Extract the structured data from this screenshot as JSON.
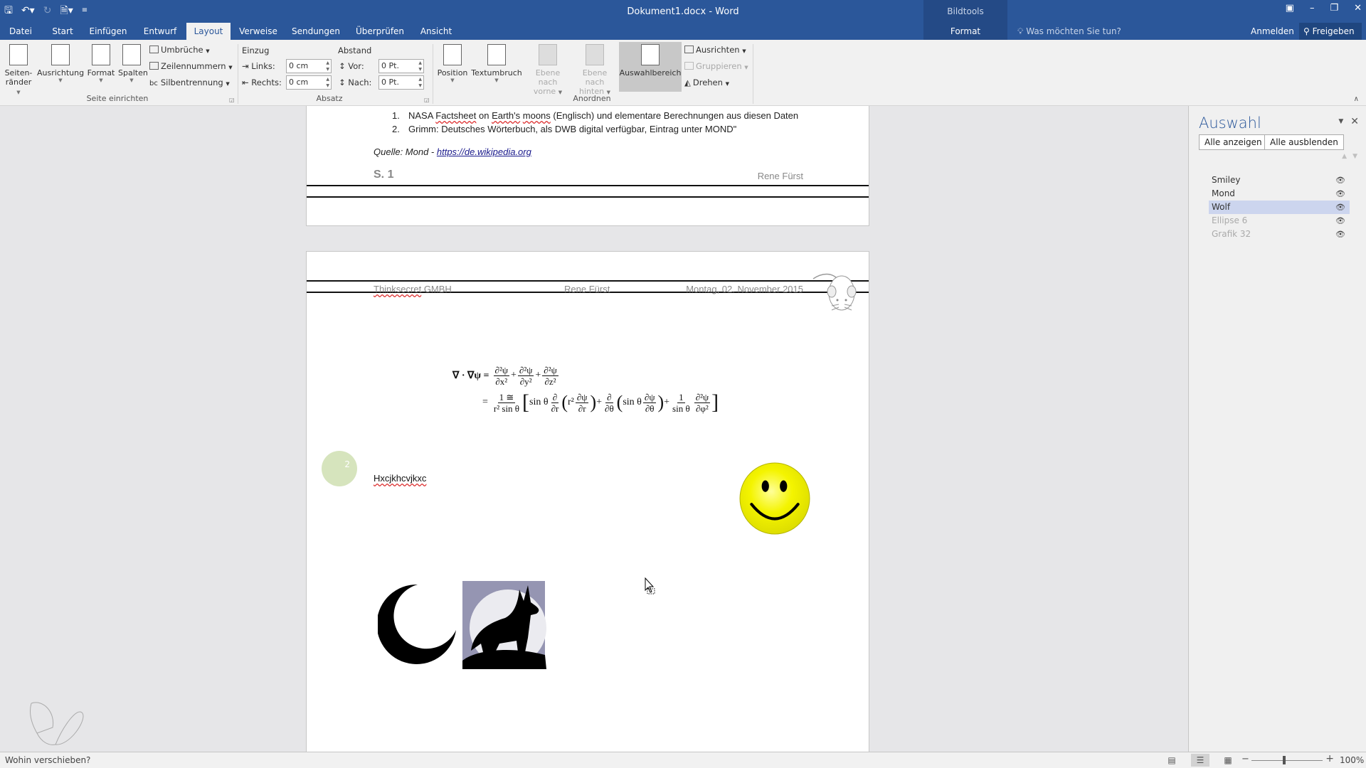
{
  "titlebar": {
    "title": "Dokument1.docx - Word",
    "contextual_group": "Bildtools",
    "qat": [
      "save-icon",
      "undo-icon",
      "redo-icon",
      "new-doc-icon",
      "customize-icon"
    ],
    "window_controls": {
      "ribbon_display": "▣",
      "minimize": "–",
      "restore": "❐",
      "close": "✕"
    }
  },
  "tabs": [
    {
      "label": "Datei"
    },
    {
      "label": "Start"
    },
    {
      "label": "Einfügen"
    },
    {
      "label": "Entwurf"
    },
    {
      "label": "Layout",
      "active": true
    },
    {
      "label": "Verweise"
    },
    {
      "label": "Sendungen"
    },
    {
      "label": "Überprüfen"
    },
    {
      "label": "Ansicht"
    },
    {
      "label": "Format"
    }
  ],
  "tell_me": "Was möchten Sie tun?",
  "account": {
    "signin": "Anmelden",
    "share": "Freigeben"
  },
  "ribbon": {
    "seite_einrichten": {
      "label": "Seite einrichten",
      "seitenraender_1": "Seiten-",
      "seitenraender_2": "ränder",
      "ausrichtung": "Ausrichtung",
      "format": "Format",
      "spalten": "Spalten",
      "umbrueche": "Umbrüche",
      "zeilennummern": "Zeilennummern",
      "silbentrennung": "Silbentrennung"
    },
    "absatz": {
      "label": "Absatz",
      "einzug": "Einzug",
      "abstand": "Abstand",
      "links_label": "Links:",
      "links_value": "0 cm",
      "rechts_label": "Rechts:",
      "rechts_value": "0 cm",
      "vor_label": "Vor:",
      "vor_value": "0 Pt.",
      "nach_label": "Nach:",
      "nach_value": "0 Pt."
    },
    "anordnen": {
      "label": "Anordnen",
      "position": "Position",
      "textumbruch": "Textumbruch",
      "ebene_vorne_1": "Ebene nach",
      "ebene_vorne_2": "vorne",
      "ebene_hinten_1": "Ebene nach",
      "ebene_hinten_2": "hinten",
      "auswahlbereich": "Auswahlbereich",
      "ausrichten": "Ausrichten",
      "gruppieren": "Gruppieren",
      "drehen": "Drehen"
    }
  },
  "document": {
    "page1": {
      "list": [
        {
          "num": "1.",
          "pre": "NASA ",
          "w1": "Factsheet",
          "mid": " on ",
          "w2": "Earth's",
          "sp": " ",
          "w3": "moons",
          "post": " (Englisch) und elementare Berechnungen aus diesen Daten"
        },
        {
          "num": "2.",
          "text": "Grimm: Deutsches Wörterbuch, als DWB digital verfügbar, Eintrag unter MOND\""
        }
      ],
      "source_prefix": "Quelle: Mond - ",
      "source_link": "https://de.wikipedia.org",
      "page_number": "S. 1",
      "footer_author": "Rene Fürst"
    },
    "page2": {
      "header_company": "Thinksecret",
      "header_company_suffix": " GMBH",
      "header_author": "Rene Fürst",
      "header_date": "Montag, 02. November 2015",
      "formula": {
        "lhs": "∇ · ∇ψ =",
        "t1n": "∂²ψ",
        "t1d": "∂x²",
        "t2n": "∂²ψ",
        "t2d": "∂y²",
        "t3n": "∂²ψ",
        "t3d": "∂z²",
        "eq": "=",
        "f1n": "1 ≅",
        "f1d": "r² sin θ",
        "sin1": "sin θ",
        "f2n": "∂",
        "f2d": "∂r",
        "r2": "r²",
        "f3n": "∂ψ",
        "f3d": "∂r",
        "f4n": "∂",
        "f4d": "∂θ",
        "sin2": "sin θ",
        "f5n": "∂ψ",
        "f5d": "∂θ",
        "f6n": "1",
        "f6d": "sin θ",
        "f7n": "∂²ψ",
        "f7d": "∂φ²",
        "plus": "+"
      },
      "circle_number": "2",
      "body_text": "Hxcjkhcvjkxc"
    }
  },
  "selection_pane": {
    "title": "Auswahl",
    "show_all": "Alle anzeigen",
    "hide_all": "Alle ausblenden",
    "items": [
      {
        "label": "Smiley",
        "state": "normal"
      },
      {
        "label": "Mond",
        "state": "normal"
      },
      {
        "label": "Wolf",
        "state": "selected"
      },
      {
        "label": "Ellipse 6",
        "state": "dim"
      },
      {
        "label": "Grafik 32",
        "state": "dim"
      }
    ]
  },
  "statusbar": {
    "message": "Wohin verschieben?",
    "zoom": "100%",
    "zoom_level_percent": 100
  },
  "colors": {
    "accent": "#2b579a",
    "selected_item": "#ccd5ee",
    "smiley": "#f2f200",
    "circle": "#d6e4bd"
  }
}
